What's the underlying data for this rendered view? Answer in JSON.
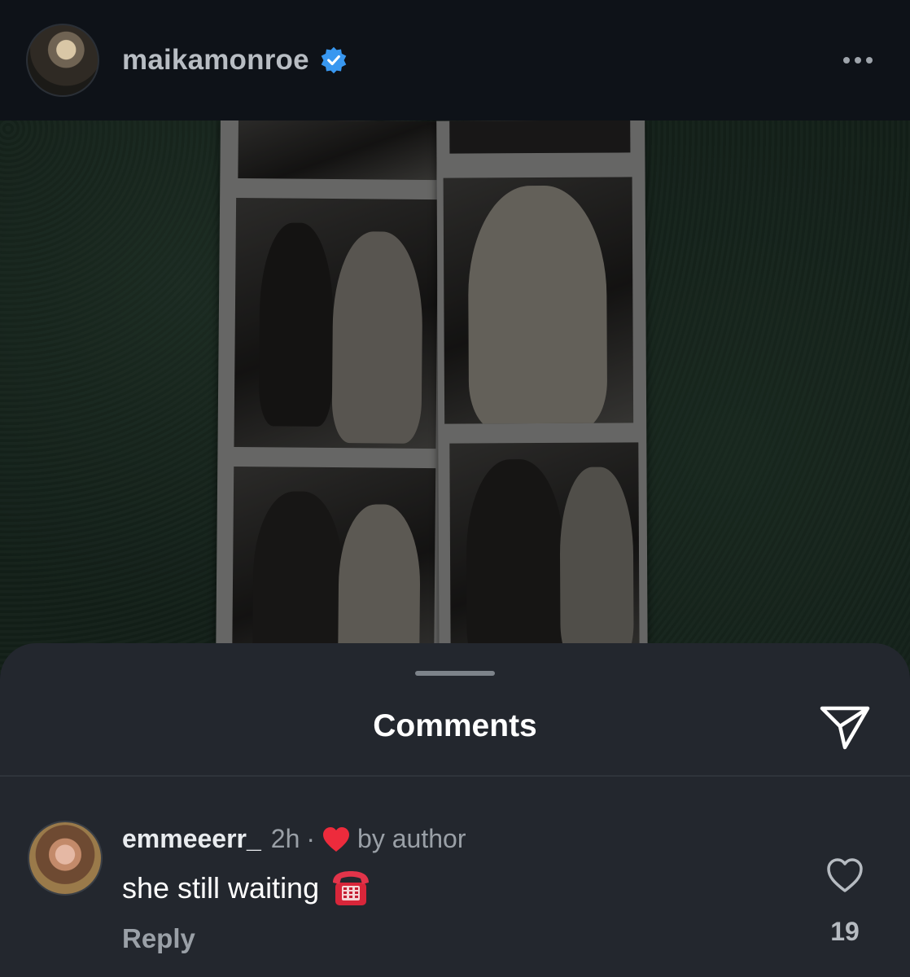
{
  "post": {
    "username": "maikamonroe",
    "verified": true,
    "more_icon": "more-horizontal-icon"
  },
  "photo": {
    "description_icon": "photobooth-strip-photo",
    "background_color": "#1d2c23"
  },
  "comments_sheet": {
    "title": "Comments",
    "share_icon": "send-icon"
  },
  "comments": [
    {
      "username": "emmeeerr_",
      "time": "2h",
      "separator": "·",
      "liked_by_author_label": "by author",
      "text": "she still waiting",
      "emoji_icon": "telephone-icon",
      "reply_label": "Reply",
      "like_count": "19"
    }
  ],
  "colors": {
    "background": "#0f1419",
    "sheet": "#23272e",
    "verified_blue": "#3897f0",
    "heart_red": "#ed2b3c"
  }
}
